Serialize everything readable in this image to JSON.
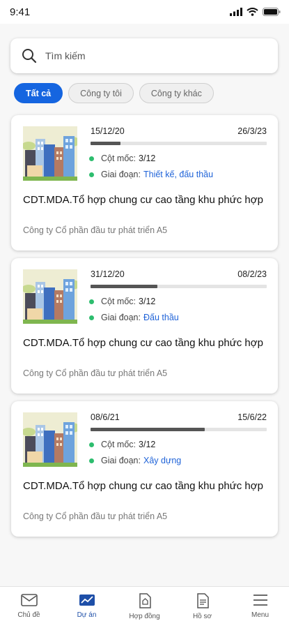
{
  "status_bar": {
    "time": "9:41"
  },
  "search": {
    "placeholder": "Tìm kiếm"
  },
  "filters": [
    "Tất cả",
    "Công ty tôi",
    "Công ty khác"
  ],
  "projects": [
    {
      "start_date": "15/12/20",
      "end_date": "26/3/23",
      "progress": 0.17,
      "milestone_label": "Cột mốc:",
      "milestone_value": "3/12",
      "stage_label": "Giai đoạn:",
      "stage_value": "Thiết kế, đấu thầu",
      "title": "CDT.MDA.Tổ hợp chung cư cao tầng khu phức hợp",
      "company": "Công ty Cổ phần đầu tư phát triển A5"
    },
    {
      "start_date": "31/12/20",
      "end_date": "08/2/23",
      "progress": 0.38,
      "milestone_label": "Cột mốc:",
      "milestone_value": "3/12",
      "stage_label": "Giai đoạn:",
      "stage_value": "Đấu thầu",
      "title": "CDT.MDA.Tổ hợp chung cư cao tầng khu phức hợp",
      "company": "Công ty Cổ phần đầu tư phát triển A5"
    },
    {
      "start_date": "08/6/21",
      "end_date": "15/6/22",
      "progress": 0.65,
      "milestone_label": "Cột mốc:",
      "milestone_value": "3/12",
      "stage_label": "Giai đoạn:",
      "stage_value": "Xây dựng",
      "title": "CDT.MDA.Tổ hợp chung cư cao tầng khu phức hợp",
      "company": "Công ty Cổ phần đầu tư phát triển A5"
    }
  ],
  "bottom_nav": [
    {
      "label": "Chủ đề",
      "icon": "mail-icon"
    },
    {
      "label": "Dự án",
      "icon": "chart-icon",
      "active": true
    },
    {
      "label": "Hợp đồng",
      "icon": "contract-icon"
    },
    {
      "label": "Hồ sơ",
      "icon": "document-icon"
    },
    {
      "label": "Menu",
      "icon": "menu-icon"
    }
  ],
  "colors": {
    "primary": "#1565e0",
    "status_dot": "#2dbd6e",
    "link": "#1f63d8",
    "nav_active": "#1e4fa8"
  }
}
